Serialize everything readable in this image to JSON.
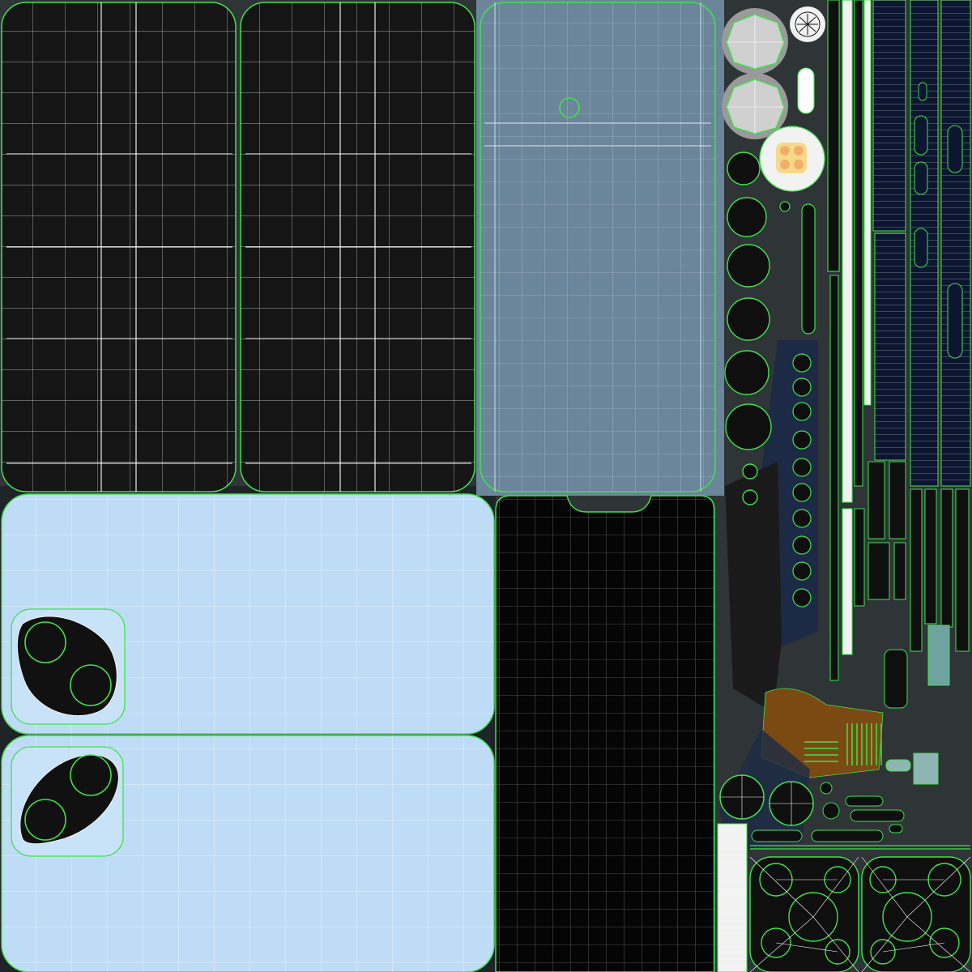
{
  "colors": {
    "background": "#2f3437",
    "screen": "#151515",
    "screen_dark": "#050505",
    "front_glass": "#6b859b",
    "back_glass": "#bfdcf6",
    "wire": "#ffffff",
    "seam": "#3ee24c",
    "lens_ring": "#9a9a9a",
    "lens_body": "#0d0d0d",
    "bracket": "#1d2a45",
    "strip": "#0c1630",
    "tan": "#7a4a12",
    "flash": "#f5d98a"
  }
}
